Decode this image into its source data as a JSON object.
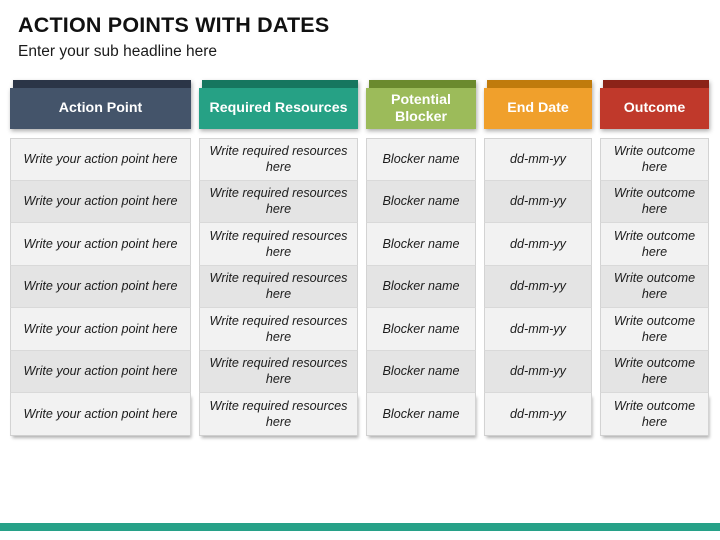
{
  "slide": {
    "title": "ACTION POINTS WITH DATES",
    "subtitle": "Enter your sub headline here",
    "accent_bar_color": "#27a188",
    "background_color": "#ffffff"
  },
  "table": {
    "columns": [
      {
        "header": "Action Point",
        "header_color": "#44546a",
        "header_cap_color": "#2b3547",
        "cell_text": "Write your  action point here"
      },
      {
        "header": "Required Resources",
        "header_color": "#26a185",
        "header_cap_color": "#16765f",
        "cell_text": "Write required resources here"
      },
      {
        "header": "Potential Blocker",
        "header_color": "#9cbb5a",
        "header_cap_color": "#6b8a2e",
        "cell_text": "Blocker name"
      },
      {
        "header": "End Date",
        "header_color": "#f0a02c",
        "header_cap_color": "#c07b0c",
        "cell_text": "dd-mm-yy"
      },
      {
        "header": "Outcome",
        "header_color": "#c0392b",
        "header_cap_color": "#8c2318",
        "cell_text": "Write outcome here"
      }
    ],
    "row_count": 7,
    "row_color_even": "#f2f2f2",
    "row_color_odd": "#e4e4e4"
  }
}
